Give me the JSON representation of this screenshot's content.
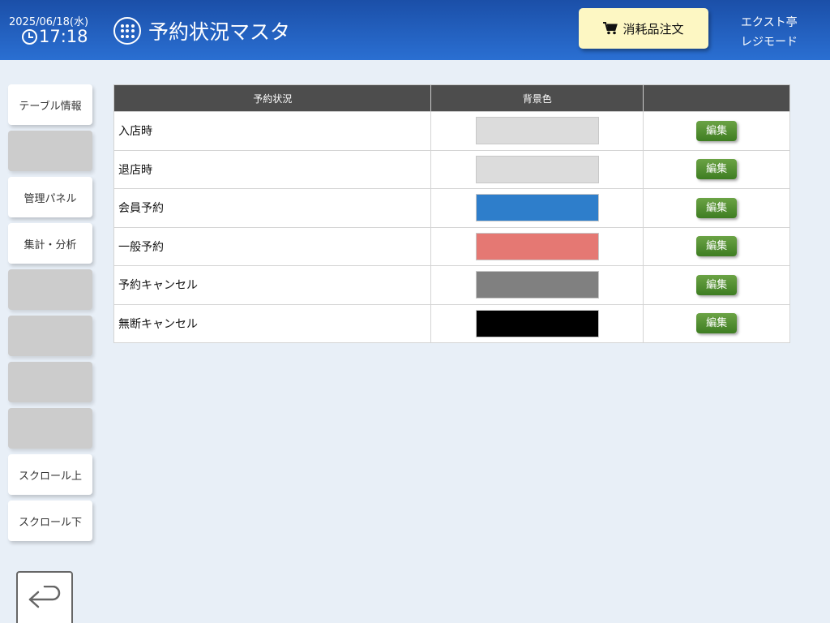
{
  "header": {
    "date": "2025/06/18(水)",
    "time": "17:18",
    "title": "予約状況マスタ",
    "order_button_label": "消耗品注文",
    "store_name": "エクスト亭",
    "mode": "レジモード",
    "colors": {
      "header_bg": "#2a6fd2",
      "order_button_bg": "#fdf7c3"
    }
  },
  "sidebar": {
    "items": [
      {
        "label": "テーブル情報"
      },
      {
        "label": ""
      },
      {
        "label": "管理パネル"
      },
      {
        "label": "集計・分析"
      },
      {
        "label": ""
      },
      {
        "label": ""
      },
      {
        "label": ""
      },
      {
        "label": ""
      },
      {
        "label": "スクロール上"
      },
      {
        "label": "スクロール下"
      }
    ],
    "back_icon": "return-arrow-icon"
  },
  "table": {
    "headers": [
      "予約状況",
      "背景色",
      ""
    ],
    "edit_label": "編集",
    "rows": [
      {
        "name": "入店時",
        "color": "#dcdcdc"
      },
      {
        "name": "退店時",
        "color": "#dcdcdc"
      },
      {
        "name": "会員予約",
        "color": "#2e7ecb"
      },
      {
        "name": "一般予約",
        "color": "#e57873"
      },
      {
        "name": "予約キャンセル",
        "color": "#808080"
      },
      {
        "name": "無断キャンセル",
        "color": "#000000"
      }
    ]
  }
}
